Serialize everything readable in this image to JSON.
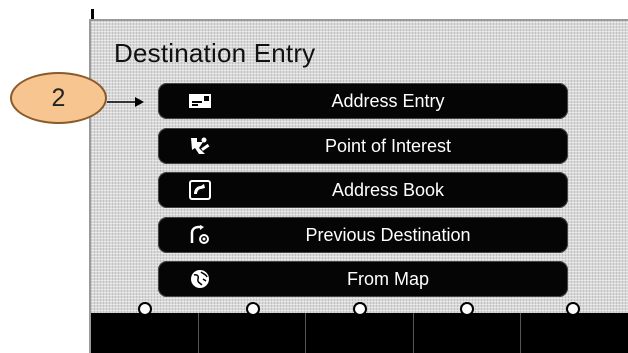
{
  "screen": {
    "title": "Destination Entry"
  },
  "menu": [
    {
      "label": "Address Entry",
      "icon": "address-entry-icon"
    },
    {
      "label": "Point of Interest",
      "icon": "point-of-interest-icon"
    },
    {
      "label": "Address Book",
      "icon": "address-book-icon"
    },
    {
      "label": "Previous Destination",
      "icon": "previous-destination-icon"
    },
    {
      "label": "From Map",
      "icon": "globe-icon"
    }
  ],
  "callout": {
    "number": "2"
  },
  "colors": {
    "button_bg": "#050505",
    "callout_fill": "#f7c690",
    "screen_bg": "#d8d8d8"
  }
}
